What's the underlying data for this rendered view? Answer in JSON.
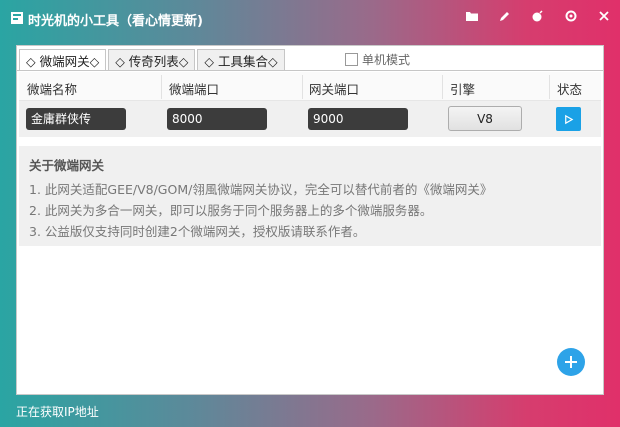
{
  "window": {
    "title": "时光机的小工具（看心情更新)"
  },
  "toolbar_icons": [
    "folder-icon",
    "pencil-icon",
    "bomb-icon",
    "gear-icon",
    "close-icon"
  ],
  "tabs": [
    {
      "label": "◇ 微端网关◇",
      "active": true
    },
    {
      "label": "◇ 传奇列表◇",
      "active": false
    },
    {
      "label": "◇ 工具集合◇",
      "active": false
    }
  ],
  "standalone_mode": {
    "label": "单机模式",
    "checked": false
  },
  "table": {
    "headers": [
      "微端名称",
      "微端端口",
      "网关端口",
      "引擎",
      "状态"
    ],
    "rows": [
      {
        "name": "金庸群侠传",
        "micro_port": "8000",
        "gateway_port": "9000",
        "engine": "V8",
        "status": "play"
      }
    ]
  },
  "info": {
    "title": "关于微端网关",
    "lines": [
      "1. 此网关适配GEE/V8/GOM/翎風微端网关协议，完全可以替代前者的《微端网关》",
      "2. 此网关为多合一网关，即可以服务于同个服务器上的多个微端服务器。",
      "3. 公益版仅支持同时创建2个微端网关，授权版请联系作者。"
    ]
  },
  "statusbar": {
    "text": "正在获取IP地址"
  },
  "colors": {
    "accent_blue": "#1aa1e6",
    "gradient_left": "#2aa5a3",
    "gradient_right": "#e0306a"
  }
}
